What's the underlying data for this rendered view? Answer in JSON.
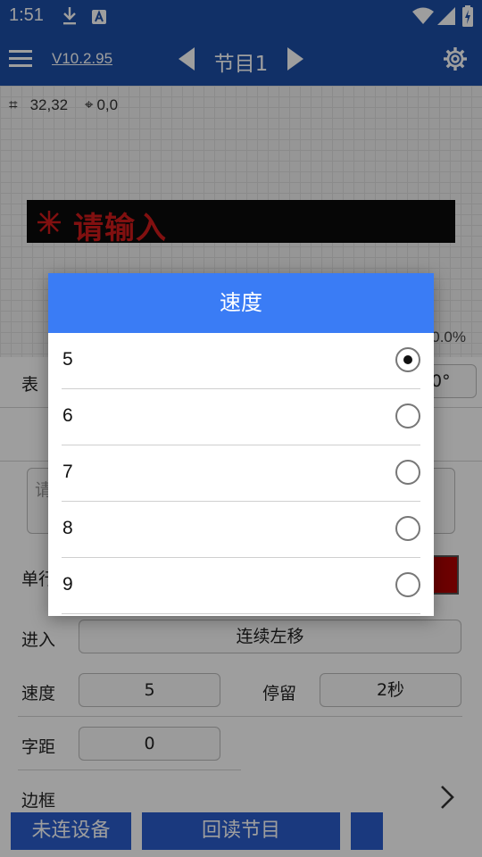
{
  "status_bar": {
    "time": "1:51"
  },
  "app_bar": {
    "version": "V10.2.95",
    "program_title": "节目1"
  },
  "canvas": {
    "coords": "32,32",
    "location": "0,0",
    "led_text": "请输入",
    "progress_text": "0.0%"
  },
  "form": {
    "enter_label": "进入",
    "enter_value": "连续左移",
    "speed_label": "速度",
    "speed_value": "5",
    "stay_label": "停留",
    "stay_value": "2秒",
    "spacing_label": "字距",
    "spacing_value": "0",
    "border_label": "边框",
    "partial_label_1": "表",
    "partial_label_2": "单行",
    "partial_input_hint": "请",
    "partial_angle": "0°"
  },
  "bottom_buttons": {
    "disconnected": "未连设备",
    "readback": "回读节目"
  },
  "dialog": {
    "title": "速度",
    "options": [
      {
        "value": "5",
        "selected": true
      },
      {
        "value": "6",
        "selected": false
      },
      {
        "value": "7",
        "selected": false
      },
      {
        "value": "8",
        "selected": false
      },
      {
        "value": "9",
        "selected": false
      }
    ]
  },
  "colors": {
    "app_bar": "#1c4ea6",
    "dialog_header": "#3a7cf5",
    "led_text": "#d11a1a",
    "button": "#2a5dcc"
  }
}
